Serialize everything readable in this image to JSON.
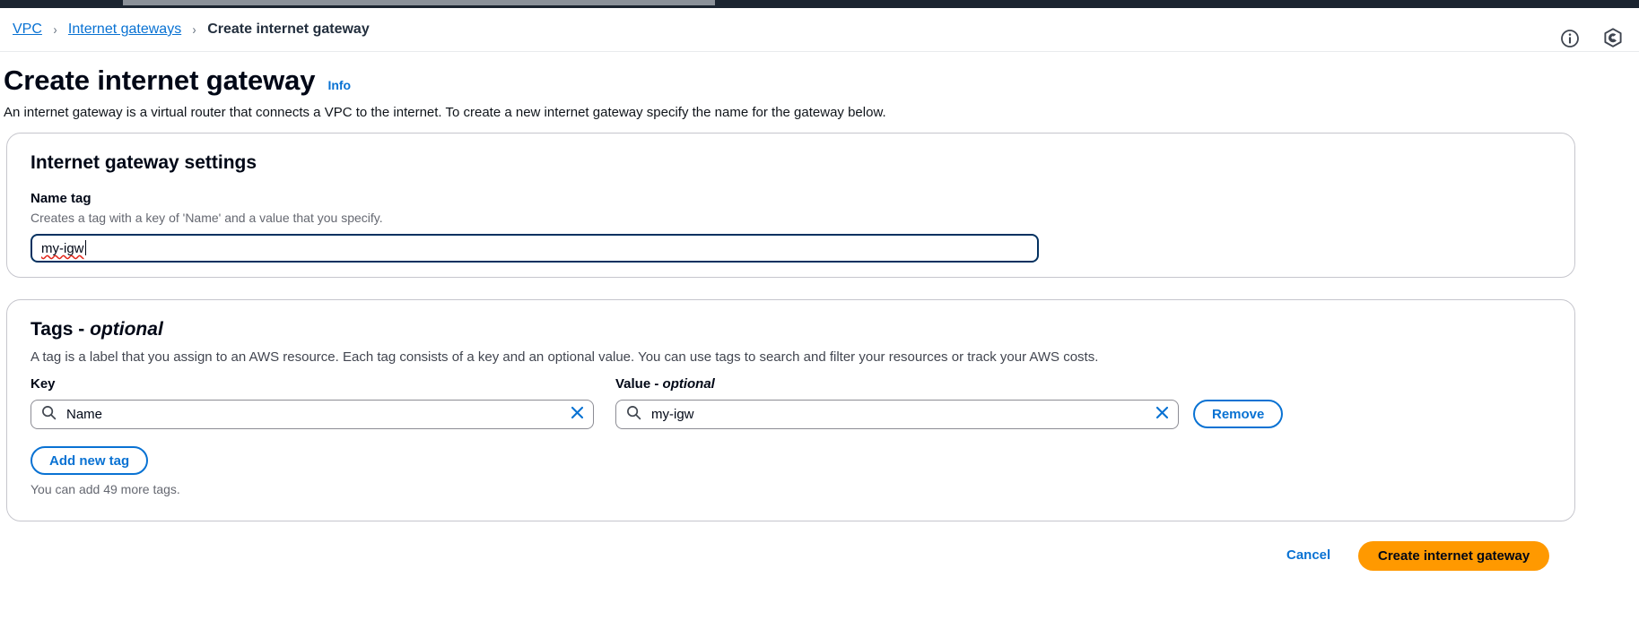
{
  "topbar": {
    "bg_color": "#1b2430",
    "segment_color": "#8b9199"
  },
  "breadcrumb": {
    "items": [
      {
        "label": "VPC",
        "type": "link"
      },
      {
        "label": "Internet gateways",
        "type": "link"
      },
      {
        "label": "Create internet gateway",
        "type": "current"
      }
    ],
    "separator": "›"
  },
  "header_icons": [
    {
      "name": "info-icon",
      "label": "Info"
    },
    {
      "name": "settings-hexagon-icon",
      "label": "Settings"
    }
  ],
  "page": {
    "title": "Create internet gateway",
    "info_link": "Info",
    "description": "An internet gateway is a virtual router that connects a VPC to the internet. To create a new internet gateway specify the name for the gateway below."
  },
  "settings_panel": {
    "title": "Internet gateway settings",
    "name_tag": {
      "label": "Name tag",
      "hint": "Creates a tag with a key of 'Name' and a value that you specify.",
      "value": "my-igw",
      "placeholder": "",
      "focused": true
    }
  },
  "tags_panel": {
    "title_main": "Tags - ",
    "title_optional": "optional",
    "description": "A tag is a label that you assign to an AWS resource. Each tag consists of a key and an optional value. You can use tags to search and filter your resources or track your AWS costs.",
    "columns": {
      "key_label": "Key",
      "value_label_main": "Value - ",
      "value_label_optional": "optional"
    },
    "rows": [
      {
        "key": "Name",
        "key_placeholder": "",
        "value": "my-igw",
        "value_placeholder": "",
        "remove_label": "Remove"
      }
    ],
    "add_tag_label": "Add new tag",
    "remaining_text": "You can add 49 more tags."
  },
  "footer": {
    "cancel_label": "Cancel",
    "submit_label": "Create internet gateway"
  },
  "colors": {
    "link": "#0972d3",
    "primary_button": "#ff9900",
    "focus_border": "#033160",
    "panel_border": "#c6c6cd",
    "muted_text": "#656871",
    "spellcheck_underline": "#e2261a"
  }
}
